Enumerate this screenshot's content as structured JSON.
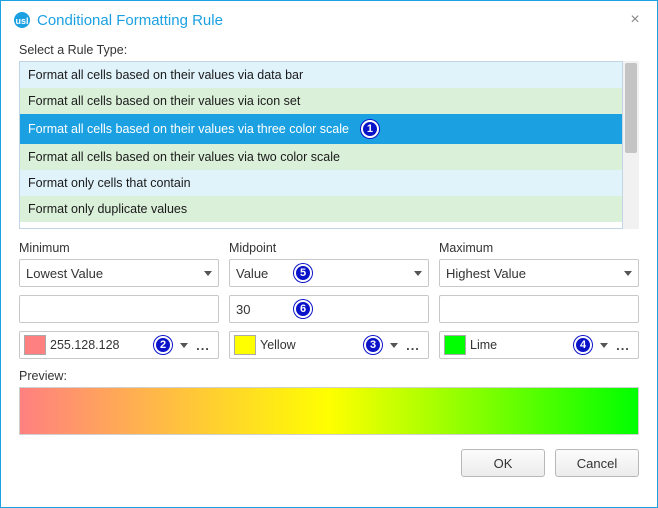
{
  "window": {
    "title": "Conditional Formatting Rule",
    "close_glyph": "×"
  },
  "rule_type": {
    "label": "Select a Rule Type:",
    "items": [
      "Format all cells based on their values via data bar",
      "Format all cells based on their values via icon set",
      "Format all cells based on their values via three color scale",
      "Format all cells based on their values via two color scale",
      "Format only cells that contain",
      "Format only duplicate values"
    ],
    "selected_index": 2
  },
  "columns": {
    "minimum": {
      "label": "Minimum",
      "type_value": "Lowest Value",
      "value": "",
      "color_label": "255.128.128",
      "color_hex": "#FF8080"
    },
    "midpoint": {
      "label": "Midpoint",
      "type_value": "Value",
      "value": "30",
      "color_label": "Yellow",
      "color_hex": "#FFFF00"
    },
    "maximum": {
      "label": "Maximum",
      "type_value": "Highest Value",
      "value": "",
      "color_label": "Lime",
      "color_hex": "#00FF00"
    }
  },
  "preview": {
    "label": "Preview:"
  },
  "buttons": {
    "ok": "OK",
    "cancel": "Cancel"
  },
  "badges": {
    "b1": "1",
    "b2": "2",
    "b3": "3",
    "b4": "4",
    "b5": "5",
    "b6": "6"
  },
  "glyphs": {
    "more": "..."
  },
  "chart_data": {
    "type": "area",
    "title": "Preview gradient",
    "stops": [
      {
        "position": 0.0,
        "color": "#FF8080"
      },
      {
        "position": 0.5,
        "color": "#FFFF00"
      },
      {
        "position": 1.0,
        "color": "#00FF00"
      }
    ]
  }
}
